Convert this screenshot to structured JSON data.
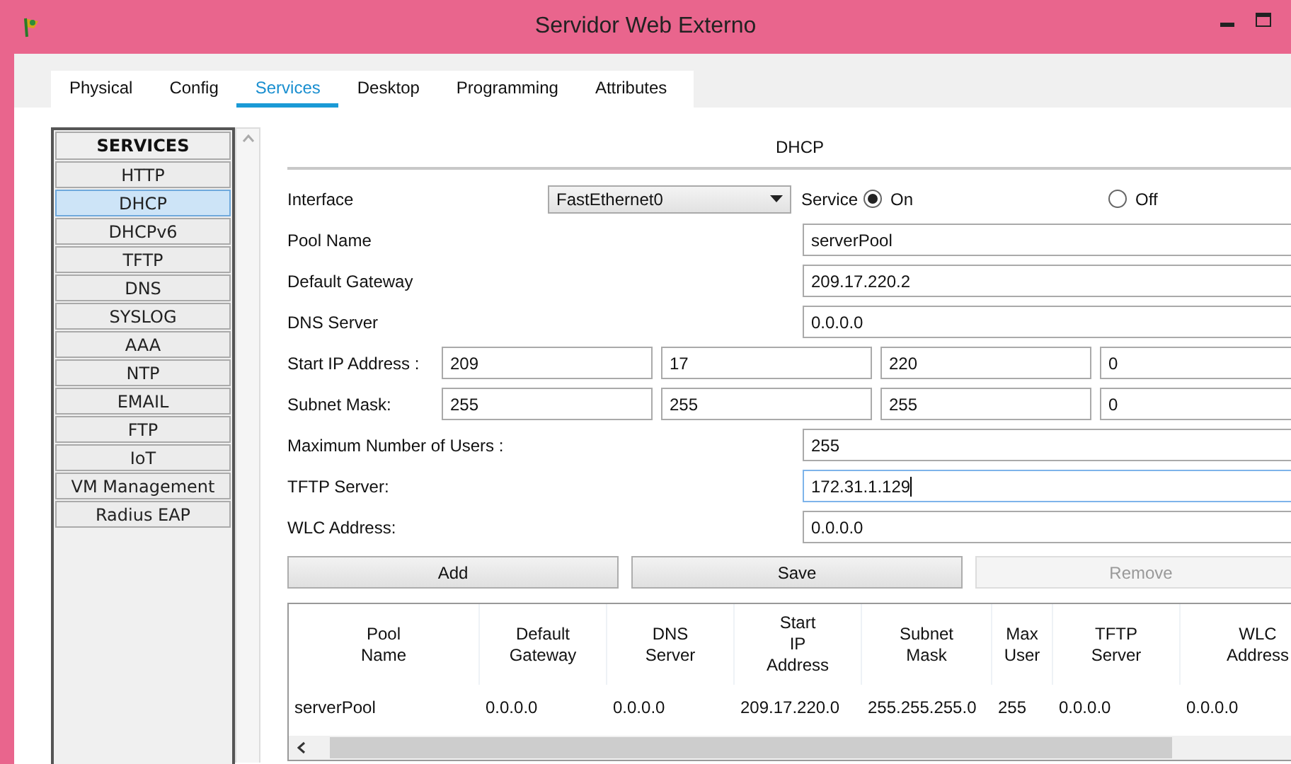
{
  "window": {
    "title": "Servidor Web Externo"
  },
  "tabs": [
    {
      "label": "Physical",
      "selected": false
    },
    {
      "label": "Config",
      "selected": false
    },
    {
      "label": "Services",
      "selected": true
    },
    {
      "label": "Desktop",
      "selected": false
    },
    {
      "label": "Programming",
      "selected": false
    },
    {
      "label": "Attributes",
      "selected": false
    }
  ],
  "services": {
    "heading": "SERVICES",
    "items": [
      {
        "label": "HTTP",
        "selected": false
      },
      {
        "label": "DHCP",
        "selected": true
      },
      {
        "label": "DHCPv6",
        "selected": false
      },
      {
        "label": "TFTP",
        "selected": false
      },
      {
        "label": "DNS",
        "selected": false
      },
      {
        "label": "SYSLOG",
        "selected": false
      },
      {
        "label": "AAA",
        "selected": false
      },
      {
        "label": "NTP",
        "selected": false
      },
      {
        "label": "EMAIL",
        "selected": false
      },
      {
        "label": "FTP",
        "selected": false
      },
      {
        "label": "IoT",
        "selected": false
      },
      {
        "label": "VM Management",
        "selected": false
      },
      {
        "label": "Radius EAP",
        "selected": false
      }
    ]
  },
  "dhcp": {
    "title": "DHCP",
    "interface": {
      "label": "Interface",
      "value": "FastEthernet0"
    },
    "service": {
      "label": "Service",
      "options": [
        {
          "label": "On",
          "selected": true
        },
        {
          "label": "Off",
          "selected": false
        }
      ]
    },
    "fields": [
      {
        "kind": "single",
        "label": "Pool Name",
        "value": "serverPool",
        "focused": false
      },
      {
        "kind": "single",
        "label": "Default Gateway",
        "value": "209.17.220.2",
        "focused": false
      },
      {
        "kind": "single",
        "label": "DNS Server",
        "value": "0.0.0.0",
        "focused": false
      },
      {
        "kind": "octets",
        "label": "Start IP Address :",
        "values": [
          "209",
          "17",
          "220",
          "0"
        ]
      },
      {
        "kind": "octets",
        "label": "Subnet Mask:",
        "values": [
          "255",
          "255",
          "255",
          "0"
        ]
      },
      {
        "kind": "single",
        "label": "Maximum Number of Users :",
        "value": "255",
        "focused": false
      },
      {
        "kind": "single",
        "label": "TFTP Server:",
        "value": "172.31.1.129",
        "focused": true
      },
      {
        "kind": "single",
        "label": "WLC Address:",
        "value": "0.0.0.0",
        "focused": false
      }
    ],
    "buttons": [
      {
        "label": "Add",
        "disabled": false
      },
      {
        "label": "Save",
        "disabled": false
      },
      {
        "label": "Remove",
        "disabled": true
      }
    ],
    "table": {
      "columns": [
        "Pool\nName",
        "Default\nGateway",
        "DNS\nServer",
        "Start\nIP\nAddress",
        "Subnet\nMask",
        "Max\nUser",
        "TFTP\nServer",
        "WLC\nAddress"
      ],
      "rows": [
        [
          "serverPool",
          "0.0.0.0",
          "0.0.0.0",
          "209.17.220.0",
          "255.255.255.0",
          "255",
          "0.0.0.0",
          "0.0.0.0"
        ]
      ]
    }
  }
}
